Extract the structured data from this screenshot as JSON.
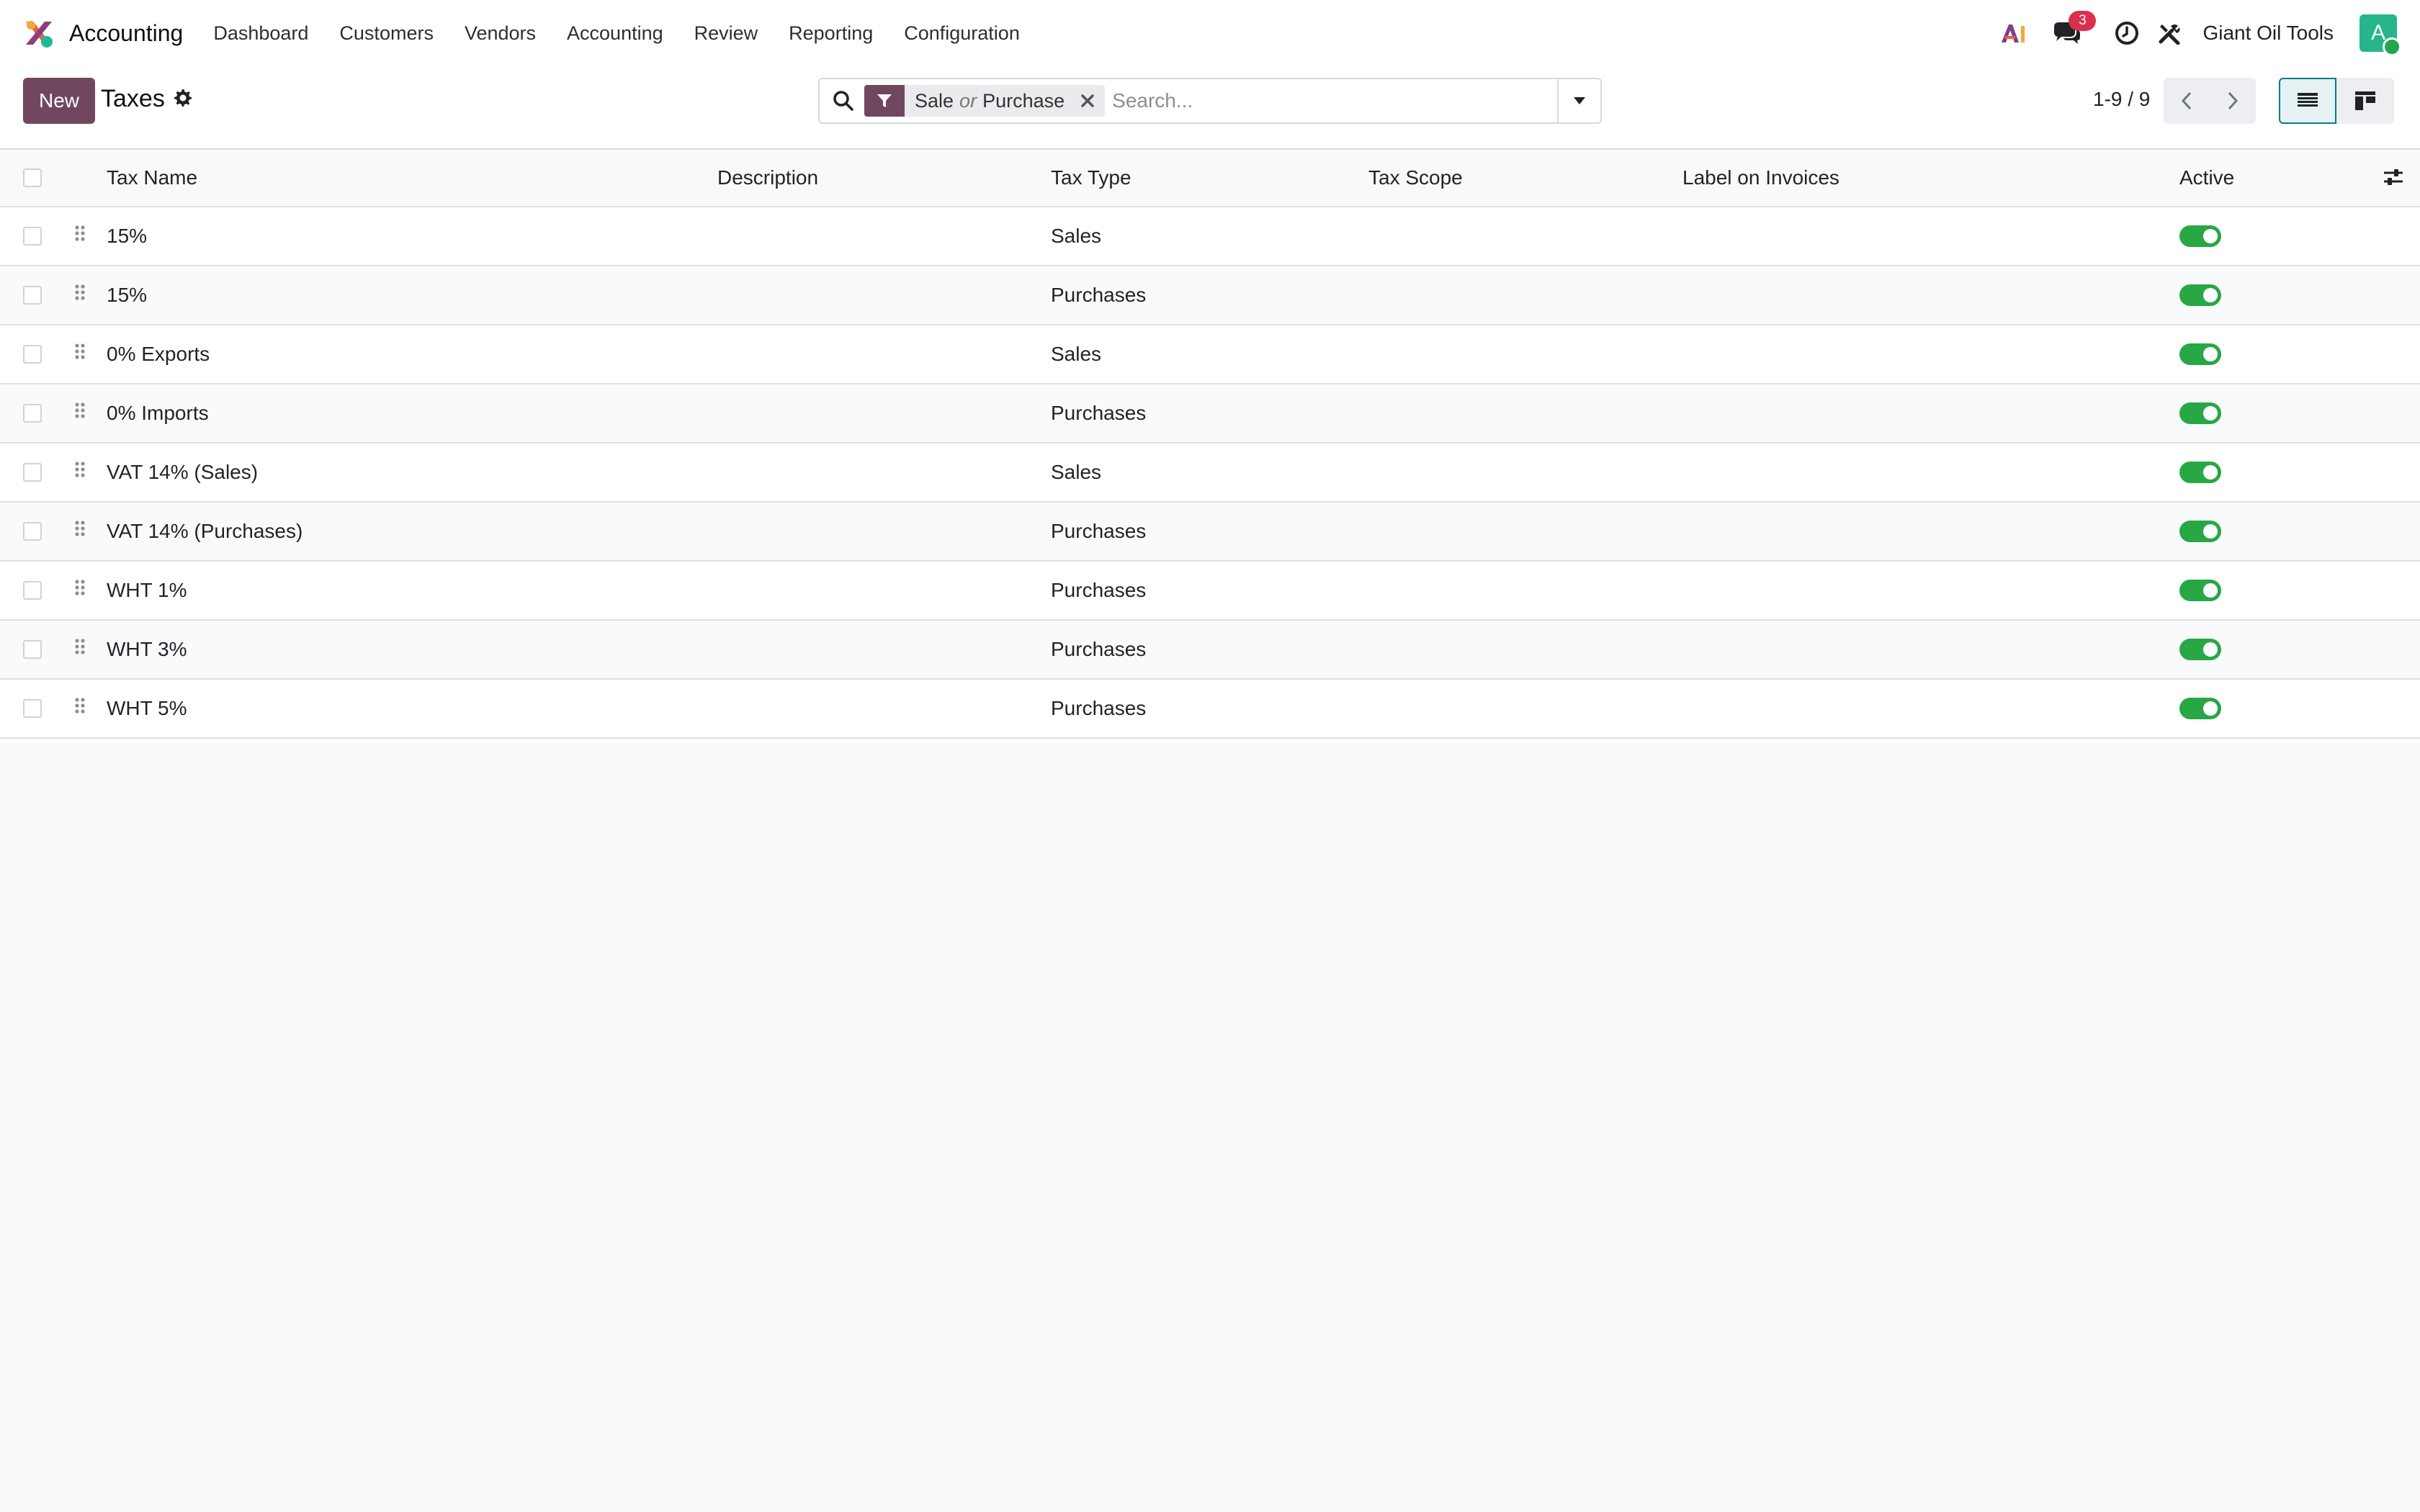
{
  "navbar": {
    "app_name": "Accounting",
    "menu": [
      "Dashboard",
      "Customers",
      "Vendors",
      "Accounting",
      "Review",
      "Reporting",
      "Configuration"
    ],
    "messages_count": "3",
    "company": "Giant Oil Tools",
    "avatar_letter": "A"
  },
  "control": {
    "new_label": "New",
    "title": "Taxes",
    "facet_left": "Sale",
    "facet_or": "or",
    "facet_right": "Purchase",
    "search_placeholder": "Search...",
    "pager": "1-9 / 9"
  },
  "table": {
    "columns": {
      "name": "Tax Name",
      "description": "Description",
      "type": "Tax Type",
      "scope": "Tax Scope",
      "label": "Label on Invoices",
      "active": "Active"
    },
    "rows": [
      {
        "name": "15%",
        "description": "",
        "type": "Sales",
        "scope": "",
        "label": "",
        "active": true
      },
      {
        "name": "15%",
        "description": "",
        "type": "Purchases",
        "scope": "",
        "label": "",
        "active": true
      },
      {
        "name": "0% Exports",
        "description": "",
        "type": "Sales",
        "scope": "",
        "label": "",
        "active": true
      },
      {
        "name": "0% Imports",
        "description": "",
        "type": "Purchases",
        "scope": "",
        "label": "",
        "active": true
      },
      {
        "name": "VAT 14% (Sales)",
        "description": "",
        "type": "Sales",
        "scope": "",
        "label": "",
        "active": true
      },
      {
        "name": "VAT 14% (Purchases)",
        "description": "",
        "type": "Purchases",
        "scope": "",
        "label": "",
        "active": true
      },
      {
        "name": "WHT 1%",
        "description": "",
        "type": "Purchases",
        "scope": "",
        "label": "",
        "active": true
      },
      {
        "name": "WHT 3%",
        "description": "",
        "type": "Purchases",
        "scope": "",
        "label": "",
        "active": true
      },
      {
        "name": "WHT 5%",
        "description": "",
        "type": "Purchases",
        "scope": "",
        "label": "",
        "active": true
      }
    ]
  },
  "colors": {
    "primary": "#71475f",
    "toggle_on": "#28a745",
    "badge": "#d9314b",
    "avatar": "#27b58c",
    "view_active": "#017e84"
  },
  "icons": {
    "logo": "accounting-logo-icon",
    "ai": "ai-icon",
    "messages": "chat-icon",
    "activities": "clock-icon",
    "debug": "tools-icon",
    "settings": "gear-icon",
    "search": "search-icon",
    "filter": "filter-icon",
    "remove_facet": "close-icon",
    "toggle_search": "caret-down-icon",
    "prev": "chevron-left-icon",
    "next": "chevron-right-icon",
    "list_view": "list-view-icon",
    "kanban_view": "kanban-view-icon",
    "optional_columns": "sliders-icon",
    "drag": "drag-handle-icon"
  }
}
